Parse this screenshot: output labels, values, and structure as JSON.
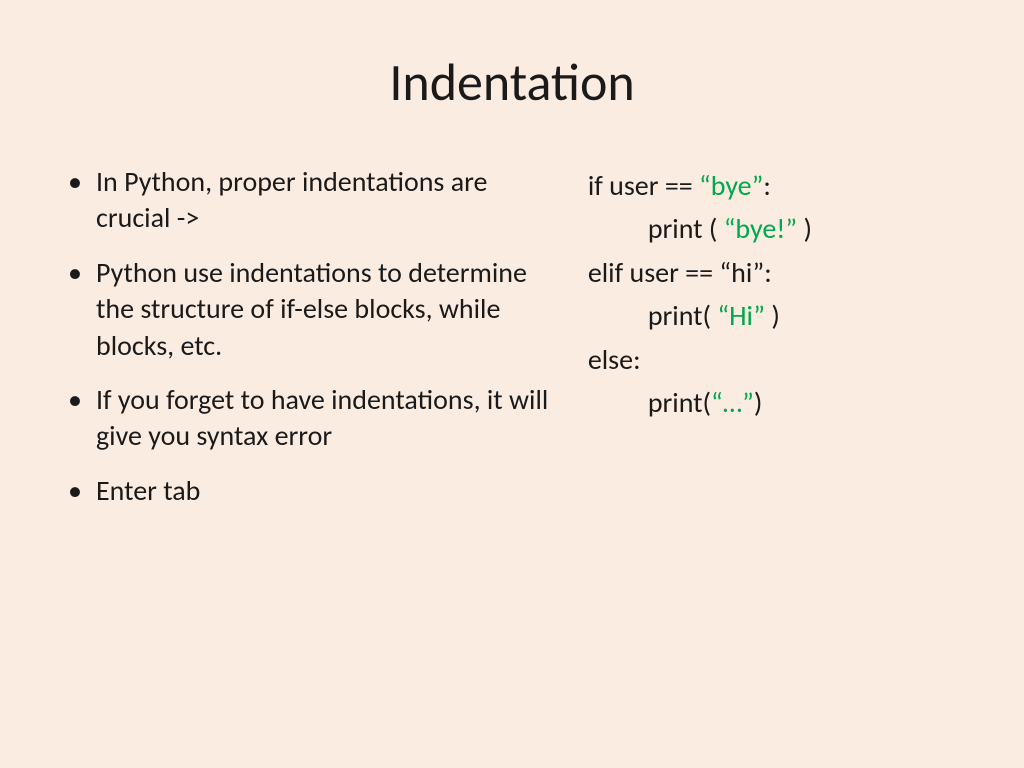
{
  "title": "Indentation",
  "bullets": [
    "In Python, proper indentations are crucial ->",
    "Python use indentations to determine the structure of if-else blocks, while blocks, etc.",
    "If you forget to have indentations, it will give you syntax error",
    "Enter tab"
  ],
  "code": {
    "line1_pre": "if user == ",
    "line1_str": "“bye”",
    "line1_post": ":",
    "line2_pre": "print ( ",
    "line2_str": "“bye!”",
    "line2_post": " )",
    "line3": "elif user == “hi”:",
    "line4_pre": "print( ",
    "line4_str": "“Hi”",
    "line4_post": " )",
    "line5": "else:",
    "line6_pre": "print(",
    "line6_str": "“…”",
    "line6_post": ")"
  }
}
